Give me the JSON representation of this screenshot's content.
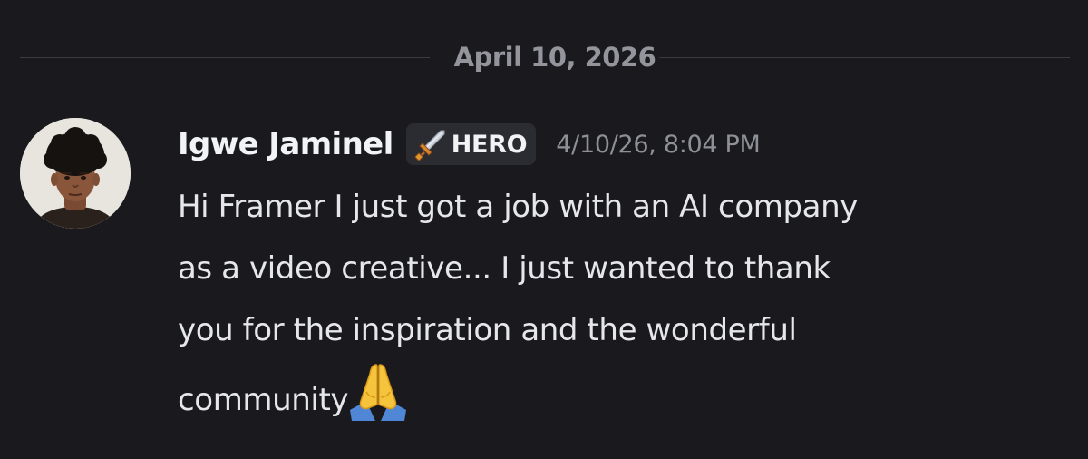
{
  "date_divider": "April 10, 2026",
  "message": {
    "username": "Igwe Jaminel",
    "role_badge": {
      "icon": "sword-icon",
      "label": "HERO"
    },
    "timestamp": "4/10/26, 8:04 PM",
    "content_lines": [
      "Hi Framer I just got a job with an AI company",
      "as a video creative... I just wanted to thank",
      "you for the inspiration and the wonderful",
      "community"
    ],
    "content_emoji": "praying-hands-emoji"
  },
  "colors": {
    "background": "#1a1a1e",
    "username": "#f2f3f5",
    "timestamp": "#8e9097",
    "divider_text": "#94959c",
    "badge_background": "#2b2c31"
  }
}
